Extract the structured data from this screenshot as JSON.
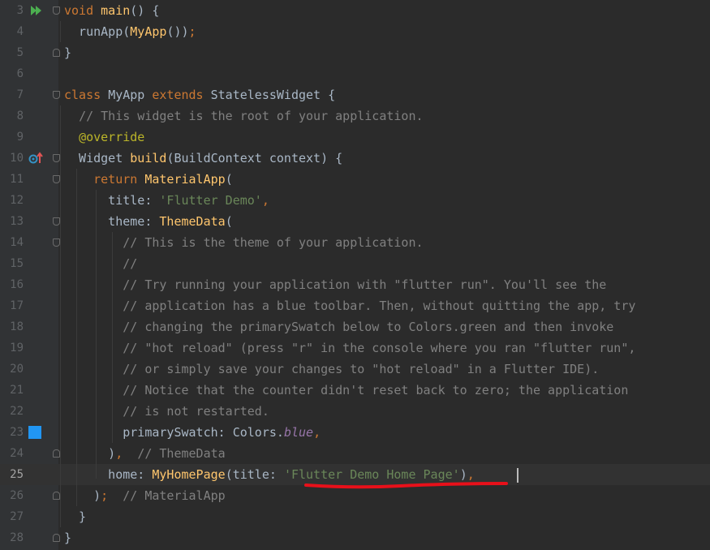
{
  "editor": {
    "swatch_color": "#2196f3",
    "underline_color": "#e8101a",
    "lines": [
      {
        "num": "3",
        "icon": "run-icon",
        "parts": [
          {
            "t": "void",
            "c": "kw"
          },
          {
            "t": " "
          },
          {
            "t": "main",
            "c": "fn"
          },
          {
            "t": "() {"
          }
        ]
      },
      {
        "num": "4",
        "parts": [
          {
            "t": "  runApp("
          },
          {
            "t": "MyApp",
            "c": "fn"
          },
          {
            "t": "())"
          },
          {
            "t": ";",
            "c": "kw"
          }
        ]
      },
      {
        "num": "5",
        "parts": [
          {
            "t": "}"
          }
        ]
      },
      {
        "num": "6",
        "parts": []
      },
      {
        "num": "7",
        "parts": [
          {
            "t": "class ",
            "c": "kw"
          },
          {
            "t": "MyApp "
          },
          {
            "t": "extends ",
            "c": "kw"
          },
          {
            "t": "StatelessWidget {"
          }
        ]
      },
      {
        "num": "8",
        "parts": [
          {
            "t": "  "
          },
          {
            "t": "// This widget is the root of your application.",
            "c": "cm"
          }
        ]
      },
      {
        "num": "9",
        "parts": [
          {
            "t": "  "
          },
          {
            "t": "@override",
            "c": "an"
          }
        ]
      },
      {
        "num": "10",
        "icon": "override-icon",
        "parts": [
          {
            "t": "  Widget "
          },
          {
            "t": "build",
            "c": "fn"
          },
          {
            "t": "(BuildContext context) {"
          }
        ]
      },
      {
        "num": "11",
        "parts": [
          {
            "t": "    "
          },
          {
            "t": "return ",
            "c": "kw"
          },
          {
            "t": "MaterialApp",
            "c": "fn"
          },
          {
            "t": "("
          }
        ]
      },
      {
        "num": "12",
        "parts": [
          {
            "t": "      title: "
          },
          {
            "t": "'Flutter Demo'",
            "c": "str"
          },
          {
            "t": ",",
            "c": "kw"
          }
        ]
      },
      {
        "num": "13",
        "parts": [
          {
            "t": "      theme: "
          },
          {
            "t": "ThemeData",
            "c": "fn"
          },
          {
            "t": "("
          }
        ]
      },
      {
        "num": "14",
        "parts": [
          {
            "t": "        "
          },
          {
            "t": "// This is the theme of your application.",
            "c": "cm"
          }
        ]
      },
      {
        "num": "15",
        "parts": [
          {
            "t": "        "
          },
          {
            "t": "//",
            "c": "cm"
          }
        ]
      },
      {
        "num": "16",
        "parts": [
          {
            "t": "        "
          },
          {
            "t": "// Try running your application with \"flutter run\". You'll see the",
            "c": "cm"
          }
        ]
      },
      {
        "num": "17",
        "parts": [
          {
            "t": "        "
          },
          {
            "t": "// application has a blue toolbar. Then, without quitting the app, try",
            "c": "cm"
          }
        ]
      },
      {
        "num": "18",
        "parts": [
          {
            "t": "        "
          },
          {
            "t": "// changing the primarySwatch below to Colors.green and then invoke",
            "c": "cm"
          }
        ]
      },
      {
        "num": "19",
        "parts": [
          {
            "t": "        "
          },
          {
            "t": "// \"hot reload\" (press \"r\" in the console where you ran \"flutter run\",",
            "c": "cm"
          }
        ]
      },
      {
        "num": "20",
        "parts": [
          {
            "t": "        "
          },
          {
            "t": "// or simply save your changes to \"hot reload\" in a Flutter IDE).",
            "c": "cm"
          }
        ]
      },
      {
        "num": "21",
        "parts": [
          {
            "t": "        "
          },
          {
            "t": "// Notice that the counter didn't reset back to zero; the application",
            "c": "cm"
          }
        ]
      },
      {
        "num": "22",
        "parts": [
          {
            "t": "        "
          },
          {
            "t": "// is not restarted.",
            "c": "cm"
          }
        ]
      },
      {
        "num": "23",
        "icon": "color-swatch",
        "parts": [
          {
            "t": "        primarySwatch: Colors."
          },
          {
            "t": "blue",
            "c": "it"
          },
          {
            "t": ",",
            "c": "kw"
          }
        ]
      },
      {
        "num": "24",
        "parts": [
          {
            "t": "      )"
          },
          {
            "t": ",",
            "c": "kw"
          },
          {
            "t": "  "
          },
          {
            "t": "// ThemeData",
            "c": "cm"
          }
        ]
      },
      {
        "num": "25",
        "current": true,
        "parts": [
          {
            "t": "      home: "
          },
          {
            "t": "MyHomePage",
            "c": "fn"
          },
          {
            "t": "(title: "
          },
          {
            "t": "'Flutter Demo Home Page'",
            "c": "str"
          },
          {
            "t": ")"
          },
          {
            "t": ",",
            "c": "kw"
          }
        ]
      },
      {
        "num": "26",
        "parts": [
          {
            "t": "    )"
          },
          {
            "t": ";",
            "c": "kw"
          },
          {
            "t": "  "
          },
          {
            "t": "// MaterialApp",
            "c": "cm"
          }
        ]
      },
      {
        "num": "27",
        "parts": [
          {
            "t": "  }"
          }
        ]
      },
      {
        "num": "28",
        "parts": [
          {
            "t": "}"
          }
        ]
      }
    ]
  }
}
